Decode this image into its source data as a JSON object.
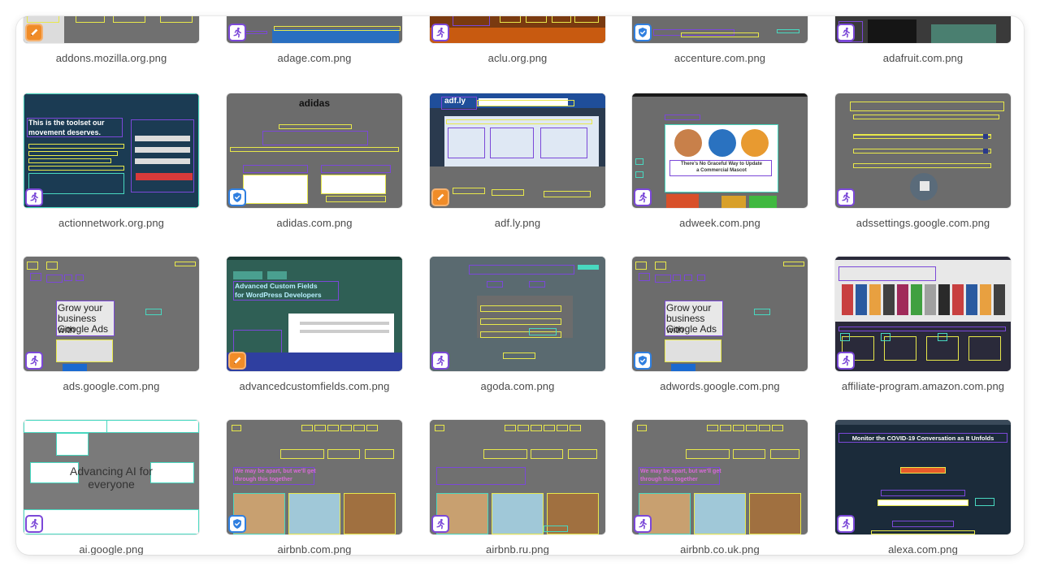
{
  "colors": {
    "run_badge": "#7b48d8",
    "shield_badge": "#2f7fe0",
    "pencil_badge": "#f08c28",
    "box_yellow": "#e8e84a",
    "box_purple": "#7b48d8",
    "box_teal": "#48d8c0",
    "thumb_gray": "#6c6c6c"
  },
  "files": [
    {
      "name": "addons.mozilla.org.png",
      "badge": "pencil-icon",
      "content": []
    },
    {
      "name": "adage.com.png",
      "badge": "run-icon",
      "content": []
    },
    {
      "name": "aclu.org.png",
      "badge": "run-icon",
      "content": []
    },
    {
      "name": "accenture.com.png",
      "badge": "shield-icon",
      "content": []
    },
    {
      "name": "adafruit.com.png",
      "badge": "run-icon",
      "content": []
    },
    {
      "name": "actionnetwork.org.png",
      "badge": "run-icon",
      "content": [
        "This is the toolset our",
        "movement deserves."
      ]
    },
    {
      "name": "adidas.com.png",
      "badge": "shield-icon",
      "content": [
        "adidas"
      ]
    },
    {
      "name": "adf.ly.png",
      "badge": "pencil-icon",
      "content": [
        "adf.ly"
      ]
    },
    {
      "name": "adweek.com.png",
      "badge": "run-icon",
      "content": [
        "There's No Graceful Way to Update",
        "a Commercial Mascot"
      ]
    },
    {
      "name": "adssettings.google.com.png",
      "badge": "run-icon",
      "content": []
    },
    {
      "name": "ads.google.com.png",
      "badge": "run-icon",
      "content": [
        "Grow your",
        "business with",
        "Google Ads"
      ]
    },
    {
      "name": "advancedcustomfields.com.png",
      "badge": "pencil-icon",
      "content": [
        "Advanced Custom Fields",
        "for WordPress Developers"
      ]
    },
    {
      "name": "agoda.com.png",
      "badge": "run-icon",
      "content": []
    },
    {
      "name": "adwords.google.com.png",
      "badge": "shield-icon",
      "content": [
        "Grow your",
        "business with",
        "Google Ads"
      ]
    },
    {
      "name": "affiliate-program.amazon.com.png",
      "badge": "run-icon",
      "content": []
    },
    {
      "name": "ai.google.png",
      "badge": "run-icon",
      "content": [
        "Advancing AI for",
        "everyone"
      ]
    },
    {
      "name": "airbnb.com.png",
      "badge": "shield-icon",
      "content": [
        "We may be apart, but we'll get",
        "through this together"
      ]
    },
    {
      "name": "airbnb.ru.png",
      "badge": "run-icon",
      "content": []
    },
    {
      "name": "airbnb.co.uk.png",
      "badge": "run-icon",
      "content": [
        "We may be apart, but we'll get",
        "through this together"
      ]
    },
    {
      "name": "alexa.com.png",
      "badge": "run-icon",
      "content": [
        "Monitor the COVID-19 Conversation as It Unfolds"
      ]
    }
  ]
}
